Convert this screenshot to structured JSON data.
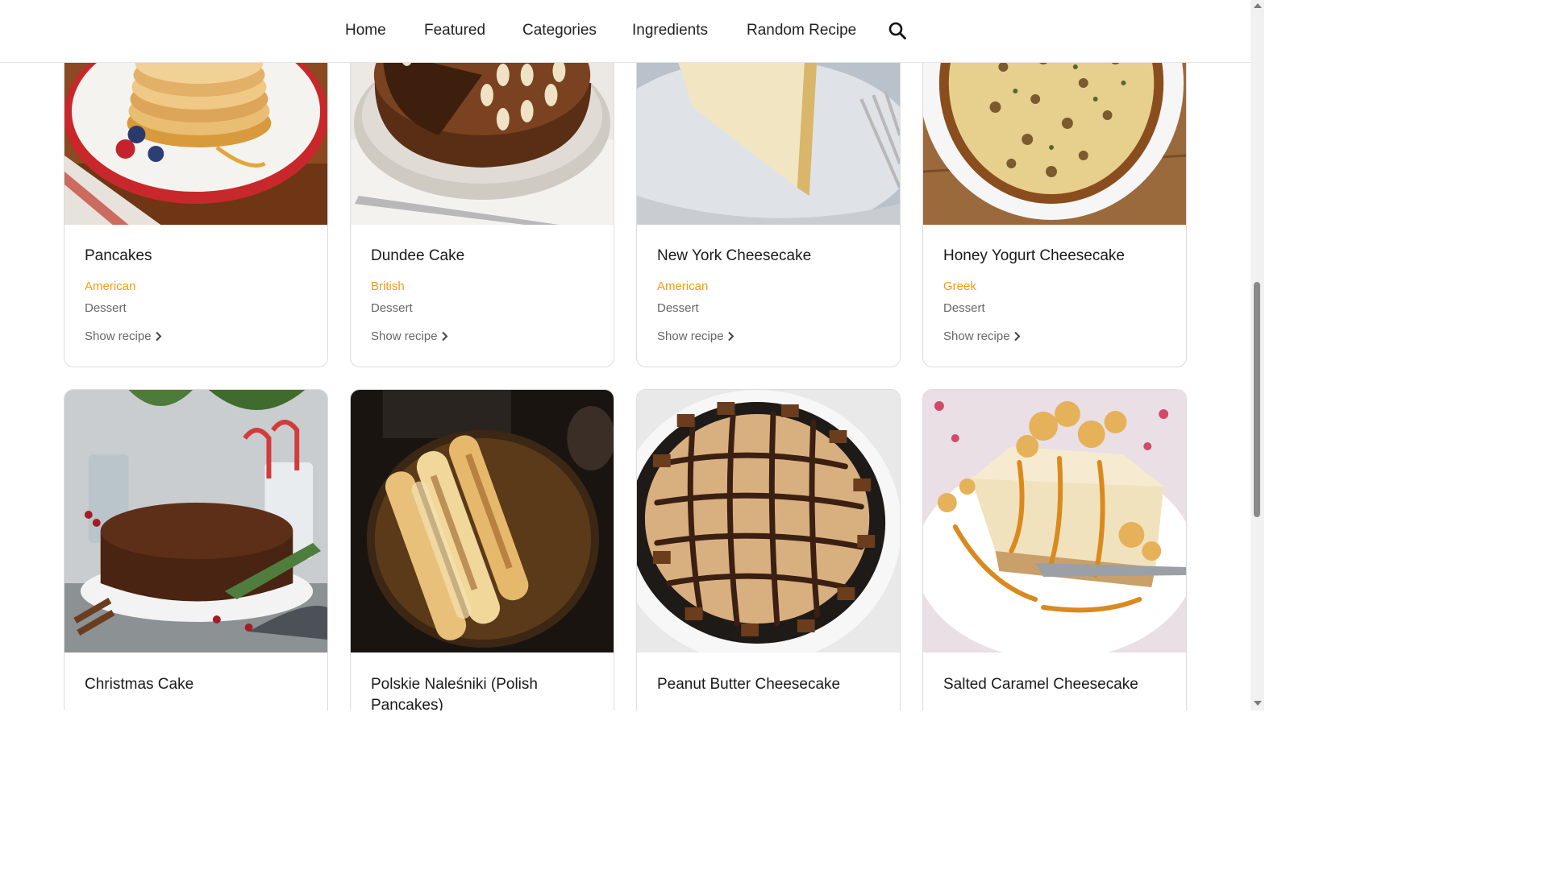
{
  "nav": {
    "items": [
      "Home",
      "Featured",
      "Categories",
      "Ingredients",
      "Random Recipe"
    ],
    "search_icon": "search-icon"
  },
  "row1": [
    {
      "title": "Pancakes",
      "area": "American",
      "category": "Dessert",
      "link": "Show recipe"
    },
    {
      "title": "Dundee Cake",
      "area": "British",
      "category": "Dessert",
      "link": "Show recipe"
    },
    {
      "title": "New York Cheesecake",
      "area": "American",
      "category": "Dessert",
      "link": "Show recipe"
    },
    {
      "title": "Honey Yogurt Cheesecake",
      "area": "Greek",
      "category": "Dessert",
      "link": "Show recipe"
    }
  ],
  "row2": [
    {
      "title": "Christmas Cake"
    },
    {
      "title": "Polskie Naleśniki (Polish Pancakes)"
    },
    {
      "title": "Peanut Butter Cheesecake"
    },
    {
      "title": "Salted Caramel Cheesecake"
    }
  ],
  "colors": {
    "area": "#f39c12",
    "muted": "#666666"
  }
}
